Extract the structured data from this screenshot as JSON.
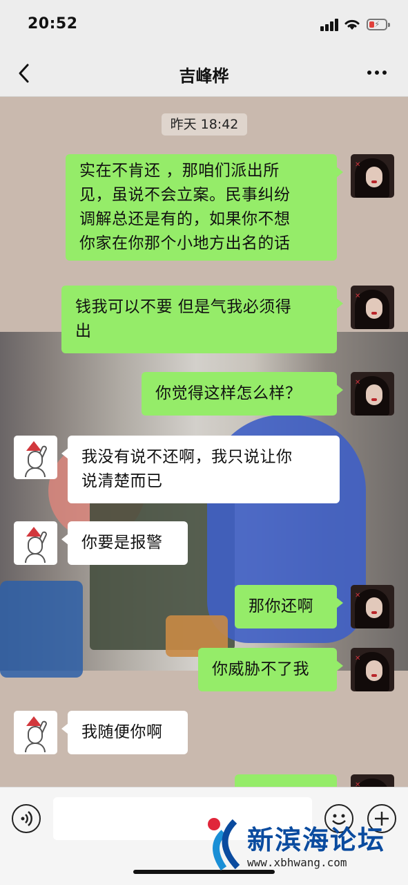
{
  "status": {
    "time": "20:52"
  },
  "header": {
    "title": "吉峰桦"
  },
  "chat": {
    "timestamp": "昨天 18:42",
    "messages": [
      {
        "side": "out",
        "lines": [
          "实在不肯还 ，那咱们派出所",
          "见，虽说不会立案。民事纠纷",
          "调解总还是有的，如果你不想",
          "你家在你那个小地方出名的话"
        ]
      },
      {
        "side": "out",
        "lines": [
          "钱我可以不要 但是气我必须得",
          "出"
        ]
      },
      {
        "side": "out",
        "lines": [
          "你觉得这样怎么样？"
        ]
      },
      {
        "side": "in",
        "lines": [
          "我没有说不还啊，我只说让你",
          "说清楚而已"
        ]
      },
      {
        "side": "in",
        "lines": [
          "你要是报警"
        ]
      },
      {
        "side": "out",
        "lines": [
          "那你还啊"
        ]
      },
      {
        "side": "out",
        "lines": [
          "你威胁不了我"
        ]
      },
      {
        "side": "in",
        "lines": [
          "我随便你啊"
        ]
      },
      {
        "side": "out",
        "lines": [
          ""
        ]
      }
    ]
  },
  "watermark": {
    "title": "新滨海论坛",
    "url": "www.xbhwang.com"
  },
  "icons": [
    "back-icon",
    "more-icon",
    "voice-icon",
    "emoji-icon",
    "plus-icon"
  ]
}
